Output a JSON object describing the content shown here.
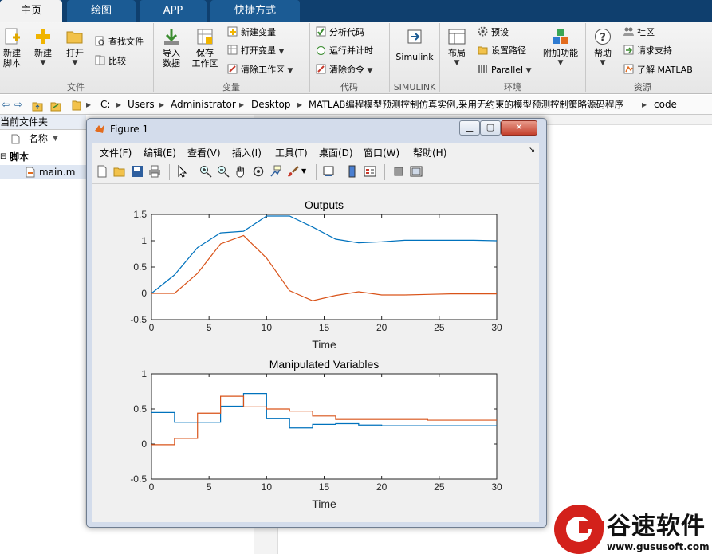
{
  "tabs": [
    {
      "label": "主页",
      "active": true
    },
    {
      "label": "绘图",
      "active": false
    },
    {
      "label": "APP",
      "active": false
    },
    {
      "label": "快捷方式",
      "active": false
    }
  ],
  "ribbon": {
    "file": {
      "new_script": "新建\n脚本",
      "new": "新建",
      "open": "打开",
      "find_files": "查找文件",
      "compare": "比较",
      "label": "文件"
    },
    "variable": {
      "import": "导入\n数据",
      "save_workspace": "保存\n工作区",
      "new_variable": "新建变量",
      "open_variable": "打开变量",
      "clear_workspace": "清除工作区",
      "label": "变量"
    },
    "code": {
      "analyze": "分析代码",
      "run_time": "运行并计时",
      "clear_commands": "清除命令",
      "label": "代码"
    },
    "simulink": {
      "button": "Simulink",
      "label": "SIMULINK"
    },
    "environment": {
      "layout": "布局",
      "preferences": "预设",
      "set_path": "设置路径",
      "parallel": "Parallel",
      "addons": "附加功能",
      "label": "环境"
    },
    "resources": {
      "help": "帮助",
      "community": "社区",
      "request_support": "请求支持",
      "learn_matlab": "了解 MATLAB",
      "label": "资源"
    }
  },
  "path": [
    "C:",
    "Users",
    "Administrator",
    "Desktop",
    "MATLAB编程模型预测控制仿真实例,采用无约束的模型预测控制策略源码程序",
    "code"
  ],
  "file_panel": {
    "title": "当前文件夹",
    "column": "名称",
    "folder": "脚本",
    "file": "main.m"
  },
  "figure": {
    "title": "Figure 1",
    "menus": [
      "文件(F)",
      "编辑(E)",
      "查看(V)",
      "插入(I)",
      "工具(T)",
      "桌面(D)",
      "窗口(W)",
      "帮助(H)"
    ]
  },
  "colors": {
    "series1": "#0072bd",
    "series2": "#d95319",
    "tabbar": "#0f3f6e",
    "tab": "#1b5b94"
  },
  "chart_data": [
    {
      "type": "line",
      "title": "Outputs",
      "xlabel": "Time",
      "ylabel": "",
      "xlim": [
        0,
        30
      ],
      "ylim": [
        -0.5,
        1.5
      ],
      "xticks": [
        0,
        5,
        10,
        15,
        20,
        25,
        30
      ],
      "yticks": [
        -0.5,
        0,
        0.5,
        1,
        1.5
      ],
      "grid": false,
      "series": [
        {
          "values": [
            [
              0,
              0
            ],
            [
              2,
              0.35
            ],
            [
              4,
              0.87
            ],
            [
              6,
              1.15
            ],
            [
              8,
              1.18
            ],
            [
              10,
              1.47
            ],
            [
              12,
              1.47
            ],
            [
              14,
              1.26
            ],
            [
              16,
              1.03
            ],
            [
              18,
              0.96
            ],
            [
              20,
              0.98
            ],
            [
              22,
              1.01
            ],
            [
              24,
              1.01
            ],
            [
              26,
              1.01
            ],
            [
              28,
              1.01
            ],
            [
              30,
              1.0
            ]
          ]
        },
        {
          "values": [
            [
              0,
              0
            ],
            [
              2,
              0
            ],
            [
              4,
              0.38
            ],
            [
              6,
              0.94
            ],
            [
              8,
              1.1
            ],
            [
              10,
              0.67
            ],
            [
              12,
              0.05
            ],
            [
              14,
              -0.14
            ],
            [
              16,
              -0.04
            ],
            [
              18,
              0.03
            ],
            [
              20,
              -0.03
            ],
            [
              22,
              -0.03
            ],
            [
              24,
              -0.02
            ],
            [
              26,
              -0.01
            ],
            [
              28,
              -0.01
            ],
            [
              30,
              -0.01
            ]
          ]
        }
      ]
    },
    {
      "type": "line",
      "title": "Manipulated Variables",
      "xlabel": "Time",
      "ylabel": "",
      "xlim": [
        0,
        30
      ],
      "ylim": [
        -0.5,
        1
      ],
      "xticks": [
        0,
        5,
        10,
        15,
        20,
        25,
        30
      ],
      "yticks": [
        -0.5,
        0,
        0.5,
        1
      ],
      "grid": false,
      "step": true,
      "series": [
        {
          "values": [
            [
              0,
              0.45
            ],
            [
              2,
              0.31
            ],
            [
              4,
              0.31
            ],
            [
              6,
              0.54
            ],
            [
              8,
              0.72
            ],
            [
              10,
              0.36
            ],
            [
              12,
              0.23
            ],
            [
              14,
              0.28
            ],
            [
              16,
              0.29
            ],
            [
              18,
              0.27
            ],
            [
              20,
              0.26
            ],
            [
              22,
              0.26
            ],
            [
              24,
              0.26
            ],
            [
              26,
              0.26
            ],
            [
              28,
              0.26
            ],
            [
              30,
              0.26
            ]
          ]
        },
        {
          "values": [
            [
              0,
              -0.01
            ],
            [
              2,
              0.08
            ],
            [
              4,
              0.44
            ],
            [
              6,
              0.68
            ],
            [
              8,
              0.53
            ],
            [
              10,
              0.5
            ],
            [
              12,
              0.47
            ],
            [
              14,
              0.4
            ],
            [
              16,
              0.35
            ],
            [
              18,
              0.35
            ],
            [
              20,
              0.35
            ],
            [
              22,
              0.35
            ],
            [
              24,
              0.34
            ],
            [
              26,
              0.34
            ],
            [
              28,
              0.34
            ],
            [
              30,
              0.34
            ]
          ]
        }
      ]
    }
  ],
  "watermark": {
    "brand": "谷速软件",
    "url": "www.gususoft.com"
  }
}
